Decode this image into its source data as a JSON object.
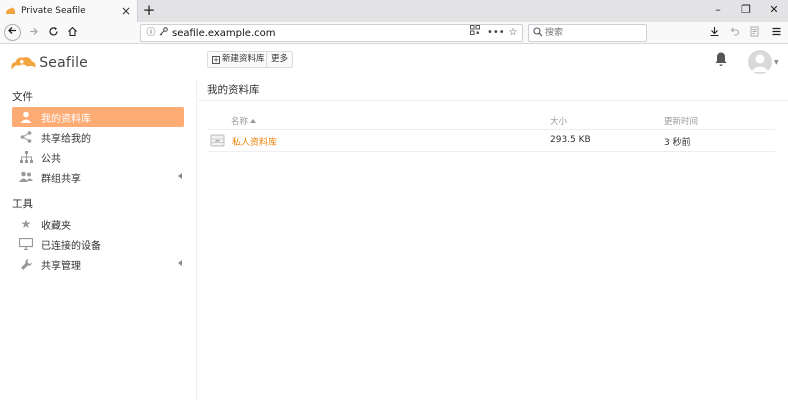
{
  "browser": {
    "tab_title": "Private Seafile",
    "tab_close": "×",
    "new_tab": "+",
    "url_host": "seafile.example.com",
    "search_placeholder": "搜索",
    "window_controls": [
      "–",
      "❐",
      "✕"
    ],
    "icons": [
      "info-icon",
      "key-icon",
      "qr-icon",
      "more-icon",
      "star-icon",
      "download-icon",
      "undo-icon",
      "reader-icon",
      "menu-icon"
    ]
  },
  "app": {
    "logo_text": "Seafile",
    "new_library_label": "新建资料库",
    "more_label": "更多",
    "accent_color": "#feac74",
    "link_color": "#eb8205"
  },
  "sidebar": {
    "files_heading": "文件",
    "files_items": [
      {
        "label": "我的资料库",
        "icon": "user-icon",
        "active": true
      },
      {
        "label": "共享给我的",
        "icon": "share-icon",
        "active": false
      },
      {
        "label": "公共",
        "icon": "org-icon",
        "active": false
      },
      {
        "label": "群组共享",
        "icon": "group-icon",
        "active": false,
        "expandable": true
      }
    ],
    "tools_heading": "工具",
    "tools_items": [
      {
        "label": "收藏夹",
        "icon": "star-icon"
      },
      {
        "label": "已连接的设备",
        "icon": "monitor-icon"
      },
      {
        "label": "共享管理",
        "icon": "wrench-icon",
        "expandable": true
      }
    ]
  },
  "main": {
    "title": "我的资料库",
    "columns": {
      "name": "名称",
      "size": "大小",
      "modified": "更新时间"
    },
    "libraries": [
      {
        "name": "私人资料库",
        "size": "293.5 KB",
        "modified": "3 秒前"
      }
    ]
  }
}
